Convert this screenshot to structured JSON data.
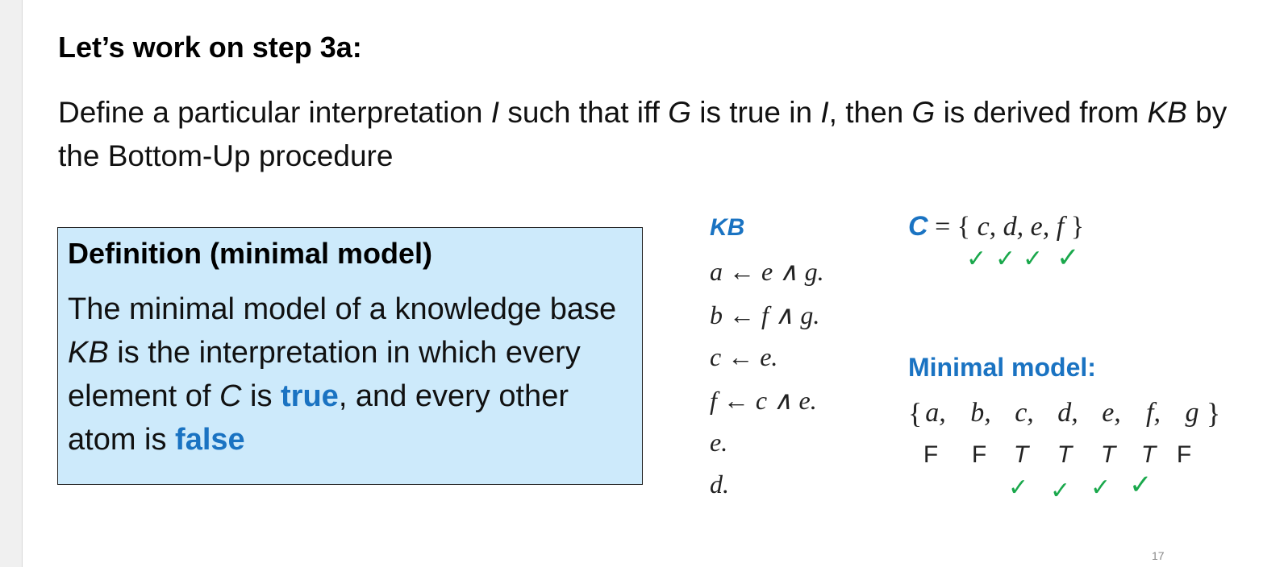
{
  "slide": {
    "title": "Let’s work on step 3a:",
    "intro": {
      "p1": "Define a particular interpretation ",
      "i1": "I",
      "p2": " such that iff ",
      "g1": "G",
      "p3": " is true in ",
      "i2": "I",
      "p4": ", then ",
      "g2": "G",
      "p5": " is derived from ",
      "kb": "KB",
      "p6": " by the Bottom-Up procedure"
    },
    "slide_number": "17"
  },
  "definition": {
    "heading": "Definition (minimal model)",
    "body": {
      "p1": "The minimal model of a knowledge base ",
      "kb": "KB",
      "p2": " is the interpretation in which every element of ",
      "c": "C",
      "p3": " is ",
      "true_word": "true",
      "p4": ", and every other atom is ",
      "false_word": "false"
    }
  },
  "kb": {
    "heading": "KB",
    "rules": [
      "a ← e ∧ g.",
      "b ← f ∧ g.",
      "c ← e.",
      "f ← c ∧ e.",
      "e.",
      "d."
    ]
  },
  "consequence_set": {
    "name": "C",
    "equals": " = { ",
    "members": "c, d, e, f",
    "close": " }",
    "checks": [
      "✓",
      "✓",
      "✓",
      "✓"
    ]
  },
  "minimal_model": {
    "heading": "Minimal model:",
    "open_brace": "{",
    "close_brace": "}",
    "atoms": [
      "a,",
      "b,",
      "c,",
      "d,",
      "e,",
      "f,",
      "g"
    ],
    "values": [
      "F",
      "F",
      "T",
      "T",
      "T",
      "T",
      "F"
    ],
    "checks": [
      "✓",
      "✓",
      "✓",
      "✓"
    ]
  },
  "colors": {
    "accent_blue": "#1a73c2",
    "definition_fill": "#cdeafb",
    "check_green": "#1aa84c"
  }
}
